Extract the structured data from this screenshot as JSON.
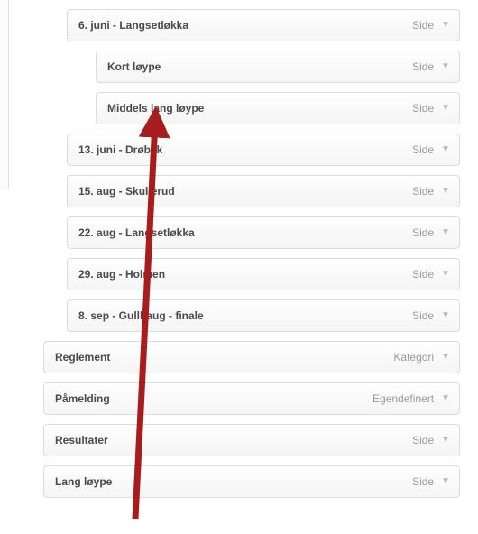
{
  "items": [
    {
      "title": "6. juni - Langsetløkka",
      "type": "Side",
      "indent": 1
    },
    {
      "title": "Kort løype",
      "type": "Side",
      "indent": 2
    },
    {
      "title": "Middels lang løype",
      "type": "Side",
      "indent": 2
    },
    {
      "title": "13. juni - Drøbak",
      "type": "Side",
      "indent": 1
    },
    {
      "title": "15. aug - Skullerud",
      "type": "Side",
      "indent": 1
    },
    {
      "title": "22. aug - Langsetløkka",
      "type": "Side",
      "indent": 1
    },
    {
      "title": "29. aug - Holmen",
      "type": "Side",
      "indent": 1
    },
    {
      "title": "8. sep - Gullhaug - finale",
      "type": "Side",
      "indent": 1
    },
    {
      "title": "Reglement",
      "type": "Kategori",
      "indent": 0
    },
    {
      "title": "Påmelding",
      "type": "Egendefinert",
      "indent": 0
    },
    {
      "title": "Resultater",
      "type": "Side",
      "indent": 0
    },
    {
      "title": "Lang løype",
      "type": "Side",
      "indent": 0
    }
  ],
  "arrow": {
    "color": "#a71c1c"
  }
}
